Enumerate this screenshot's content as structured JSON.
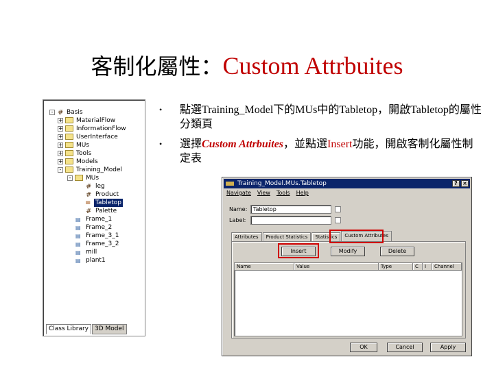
{
  "slide": {
    "title_zh": "客制化屬性：",
    "title_en": "Custom Attrbuites",
    "bullets": [
      {
        "marker": "•",
        "text_part1": "點選Training_Model下的MUs中的Tabletop，開啟Tabletop的屬性分類頁"
      },
      {
        "marker": "•",
        "text_part1": "選擇",
        "text_highlight1": "Custom Attrbuites",
        "text_part2": "，並點選",
        "text_highlight2": "Insert",
        "text_part3": "功能，開啟客制化屬性制定表"
      }
    ]
  },
  "tree": {
    "items": [
      {
        "label": "Basis",
        "icon": "grid-icon",
        "expander": "-"
      },
      {
        "label": "MaterialFlow",
        "icon": "folder-icon",
        "expander": "+"
      },
      {
        "label": "InformationFlow",
        "icon": "folder-icon",
        "expander": "+"
      },
      {
        "label": "UserInterface",
        "icon": "folder-icon",
        "expander": "+"
      },
      {
        "label": "MUs",
        "icon": "folder-icon",
        "expander": "+"
      },
      {
        "label": "Tools",
        "icon": "folder-icon",
        "expander": "+"
      },
      {
        "label": "Models",
        "icon": "folder-icon",
        "expander": "+"
      },
      {
        "label": "Training_Model",
        "icon": "folder-icon",
        "expander": "-"
      },
      {
        "label": "MUs",
        "icon": "folder-icon",
        "expander": "-"
      },
      {
        "label": "leg",
        "icon": "grid-icon"
      },
      {
        "label": "Product",
        "icon": "grid-icon"
      },
      {
        "label": "Tabletop",
        "icon": "entity-icon",
        "selected": true
      },
      {
        "label": "Palette",
        "icon": "grid-icon"
      },
      {
        "label": "Frame_1",
        "icon": "frame-icon"
      },
      {
        "label": "Frame_2",
        "icon": "frame-icon"
      },
      {
        "label": "Frame_3_1",
        "icon": "frame-icon"
      },
      {
        "label": "Frame_3_2",
        "icon": "frame-icon"
      },
      {
        "label": "mill",
        "icon": "frame-icon"
      },
      {
        "label": "plant1",
        "icon": "frame-icon"
      }
    ],
    "tabs": [
      "Class Library",
      "3D Model"
    ]
  },
  "dialog": {
    "title": "Training_Model.MUs.Tabletop",
    "help_btn": "?",
    "close_btn": "×",
    "menu": [
      "Navigate",
      "View",
      "Tools",
      "Help"
    ],
    "name_label": "Name:",
    "name_value": "Tabletop",
    "label_label": "Label:",
    "label_value": "",
    "tabs": [
      "Attributes",
      "Product Statistics",
      "Statistics",
      "Custom Attributes"
    ],
    "active_tab": "Custom Attributes",
    "insert_btn": "Insert",
    "modify_btn": "Modify",
    "delete_btn": "Delete",
    "columns": [
      "Name",
      "Value",
      "Type",
      "C",
      "I",
      "Channel"
    ],
    "ok_btn": "OK",
    "cancel_btn": "Cancel",
    "apply_btn": "Apply"
  },
  "colors": {
    "accent_red": "#c00000",
    "highlight_box": "#d00000",
    "titlebar": "#0a246a",
    "dialog_bg": "#d4d0c8"
  }
}
